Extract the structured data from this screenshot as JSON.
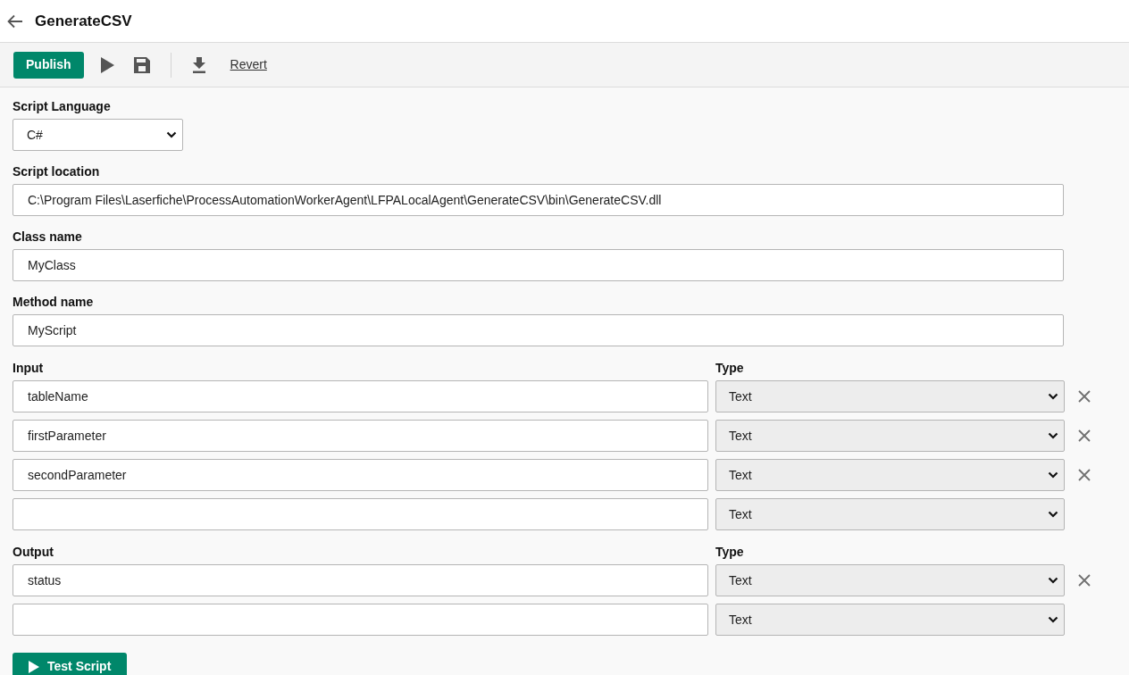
{
  "header": {
    "title": "GenerateCSV"
  },
  "toolbar": {
    "publish": "Publish",
    "revert": "Revert"
  },
  "script_language": {
    "label": "Script Language",
    "value": "C#"
  },
  "script_location": {
    "label": "Script location",
    "value": "C:\\Program Files\\Laserfiche\\ProcessAutomationWorkerAgent\\LFPALocalAgent\\GenerateCSV\\bin\\GenerateCSV.dll"
  },
  "class_name": {
    "label": "Class name",
    "value": "MyClass"
  },
  "method_name": {
    "label": "Method name",
    "value": "MyScript"
  },
  "inputs": {
    "label": "Input",
    "type_label": "Type",
    "rows": [
      {
        "value": "tableName",
        "type": "Text",
        "removable": true
      },
      {
        "value": "firstParameter",
        "type": "Text",
        "removable": true
      },
      {
        "value": "secondParameter",
        "type": "Text",
        "removable": true
      },
      {
        "value": "",
        "type": "Text",
        "removable": false
      }
    ]
  },
  "outputs": {
    "label": "Output",
    "type_label": "Type",
    "rows": [
      {
        "value": "status",
        "type": "Text",
        "removable": true
      },
      {
        "value": "",
        "type": "Text",
        "removable": false
      }
    ]
  },
  "test_button": "Test Script"
}
